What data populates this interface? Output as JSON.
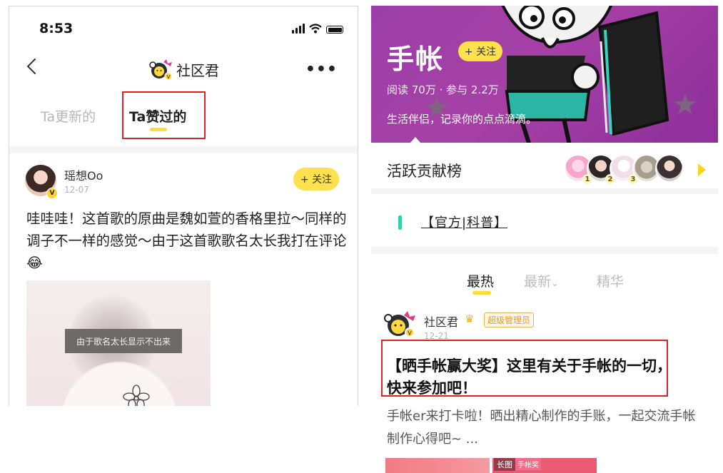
{
  "left": {
    "status": {
      "time": "8:53"
    },
    "nav": {
      "title": "社区君",
      "more": "•••"
    },
    "tabs": [
      {
        "label": "Ta更新的",
        "active": false
      },
      {
        "label": "Ta赞过的",
        "active": true
      }
    ],
    "post": {
      "author": "瑶想Oo",
      "date": "12-07",
      "badge": "V",
      "follow_label": "+ 关注",
      "text": "哇哇哇！这首歌的原曲是魏如萱的香格里拉～同样的调子不一样的感觉～由于这首歌歌名太长我打在评论😂",
      "image_label": "由于歌名太长显示不出来"
    }
  },
  "right": {
    "banner": {
      "title": "手帐",
      "follow_label": "+ 关注",
      "stats": "阅读 70万 · 参与 2.2万",
      "desc": "生活伴侣，记录你的点点滴滴。"
    },
    "rank": {
      "title": "活跃贡献榜",
      "places": [
        "1",
        "2",
        "3"
      ]
    },
    "pinned": {
      "label": "【官方|科普】"
    },
    "feed_tabs": [
      {
        "label": "最热",
        "active": true
      },
      {
        "label": "最新",
        "active": false,
        "suffix": "⌄"
      },
      {
        "label": "精华",
        "active": false
      }
    ],
    "post": {
      "author": "社区君",
      "role": "超级管理员",
      "date": "12-21",
      "title": "【晒手帐赢大奖】这里有关于手帐的一切，快来参加吧！",
      "body": "手帐er来打卡啦！晒出精心制作的手账，一起交流手帐制作心得吧~ ...",
      "thumb_tags": [
        "长图",
        "手帐奖"
      ]
    }
  },
  "colors": {
    "accent_yellow": "#ffe14d",
    "banner_purple": "#9a3fa6",
    "highlight_red": "#e02121",
    "pin_green": "#33d1a8"
  }
}
